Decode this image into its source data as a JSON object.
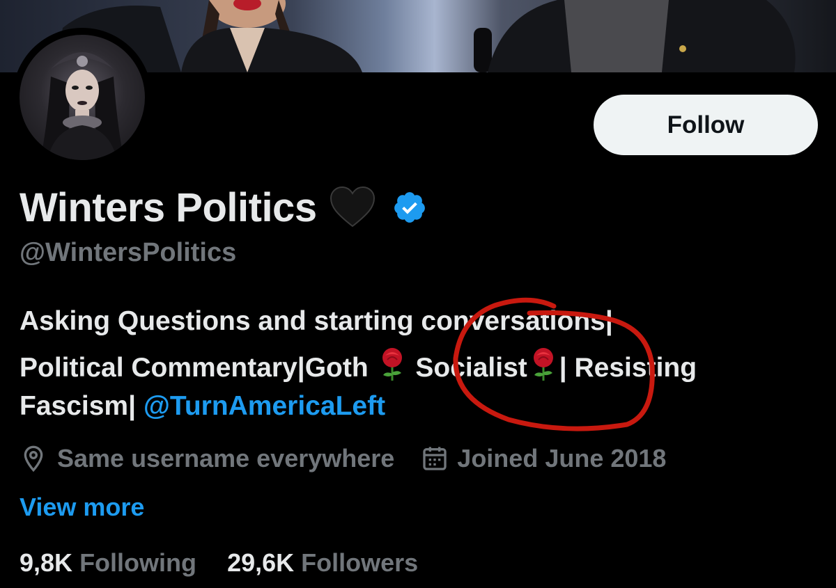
{
  "profile": {
    "display_name": "Winters Politics",
    "handle": "@WintersPolitics",
    "follow_label": "Follow",
    "bio": {
      "line1": "Asking Questions and starting conversations|",
      "line2_a": "Political Commentary|Goth",
      "line2_b": "Socialist",
      "line2_c": "| Resisting",
      "line3_a": "Fascism|",
      "mention": "@TurnAmericaLeft"
    },
    "location": "Same username everywhere",
    "joined": "Joined June 2018",
    "view_more_label": "View more",
    "following_count": "9,8K",
    "following_label": "Following",
    "followers_count": "29,6K",
    "followers_label": "Followers"
  },
  "icons": {
    "heart": "black-heart-icon",
    "verified": "verified-badge-icon",
    "rose": "rose-emoji-icon",
    "location": "location-pin-icon",
    "calendar": "calendar-icon"
  },
  "colors": {
    "background": "#000000",
    "primary_text": "#e7e9ea",
    "secondary_text": "#71767b",
    "accent": "#1d9bf0",
    "follow_bg": "#eff3f4",
    "annotation": "#c8190f"
  }
}
